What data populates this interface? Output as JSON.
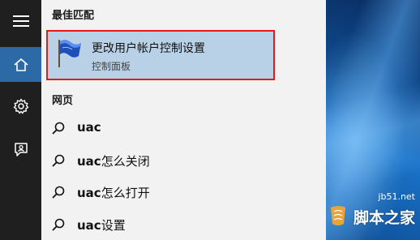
{
  "sidebar": {
    "items": [
      {
        "name": "menu",
        "icon": "hamburger-icon"
      },
      {
        "name": "home",
        "icon": "home-icon",
        "active": true
      },
      {
        "name": "settings",
        "icon": "gear-icon"
      },
      {
        "name": "feedback",
        "icon": "feedback-icon"
      }
    ]
  },
  "best_match": {
    "heading": "最佳匹配",
    "title": "更改用户帐户控制设置",
    "subtitle": "控制面板",
    "icon": "flag-icon"
  },
  "web": {
    "heading": "网页",
    "results": [
      {
        "query_bold": "uac",
        "suffix": ""
      },
      {
        "query_bold": "uac",
        "suffix": "怎么关闭"
      },
      {
        "query_bold": "uac",
        "suffix": "怎么打开"
      },
      {
        "query_bold": "uac",
        "suffix": "设置"
      }
    ]
  },
  "watermark": {
    "domain": "jb51.net",
    "name": "脚本之家"
  },
  "colors": {
    "rail_bg": "#1f1f1f",
    "rail_active": "#2b6aa5",
    "panel_bg": "#f2f2f2",
    "highlight_bg": "#b9d1e6",
    "highlight_border": "#e21a1a"
  }
}
